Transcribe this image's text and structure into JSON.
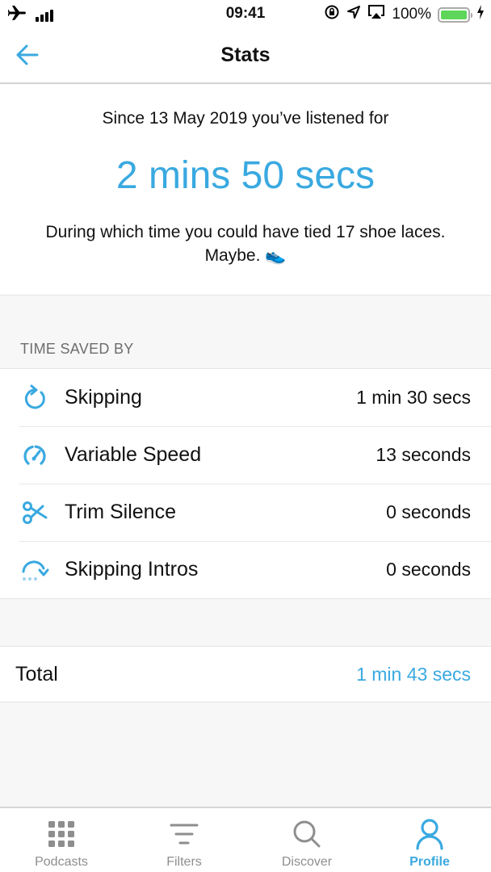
{
  "status_bar": {
    "time": "09:41",
    "battery_percent": "100%",
    "battery_level": 1.0,
    "icons": [
      "airplane-icon",
      "signal-icon",
      "rotation-lock-icon",
      "location-icon",
      "airplay-icon",
      "battery-icon",
      "charging-icon"
    ]
  },
  "nav": {
    "title": "Stats",
    "back_icon": "arrow-left-icon"
  },
  "summary": {
    "since_text": "Since 13 May 2019 you’ve listened for",
    "listened_time": "2 mins 50 secs",
    "fun_fact": "During which time you could have tied 17 shoe laces. Maybe. 👟"
  },
  "time_saved": {
    "header": "TIME SAVED BY",
    "rows": [
      {
        "icon": "skip-forward-icon",
        "label": "Skipping",
        "value": "1 min 30 secs"
      },
      {
        "icon": "speedometer-icon",
        "label": "Variable Speed",
        "value": "13 seconds"
      },
      {
        "icon": "scissors-icon",
        "label": "Trim Silence",
        "value": "0 seconds"
      },
      {
        "icon": "skip-intro-icon",
        "label": "Skipping Intros",
        "value": "0 seconds"
      }
    ]
  },
  "total": {
    "label": "Total",
    "value": "1 min 43 secs"
  },
  "tabbar": {
    "active": "Profile",
    "tabs": [
      {
        "icon": "grid-icon",
        "label": "Podcasts"
      },
      {
        "icon": "filter-icon",
        "label": "Filters"
      },
      {
        "icon": "search-icon",
        "label": "Discover"
      },
      {
        "icon": "profile-icon",
        "label": "Profile"
      }
    ]
  },
  "colors": {
    "accent": "#3aa9e0",
    "text": "#111111",
    "secondary_text": "#6d6d6d",
    "tab_inactive": "#8e8e8e",
    "background": "#f7f7f7",
    "battery_fill": "#5ed65a"
  }
}
